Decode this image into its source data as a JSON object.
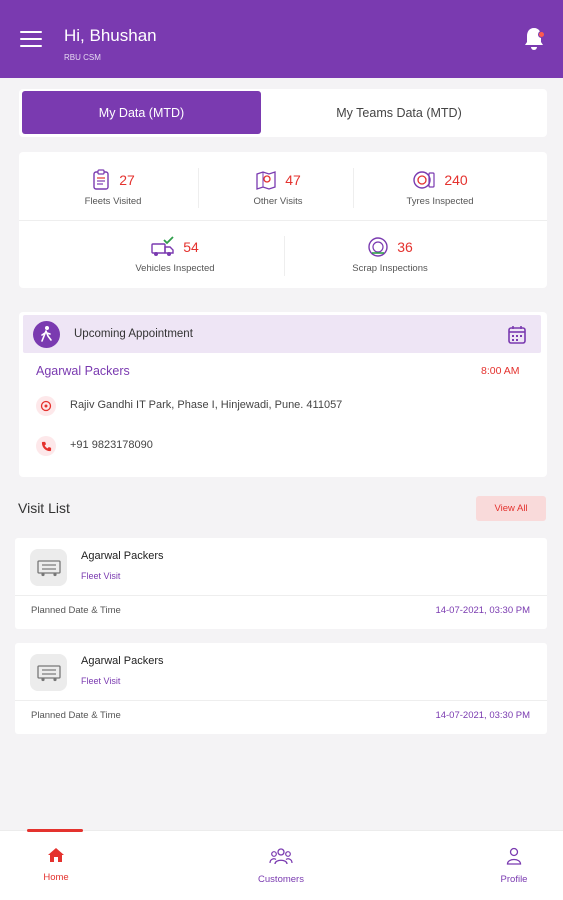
{
  "header": {
    "greeting": "Hi, Bhushan",
    "role": "RBU CSM",
    "bg_color": "#7a3ab0"
  },
  "tabs": [
    {
      "label": "My Data (MTD)",
      "active": true
    },
    {
      "label": "My Teams Data (MTD)",
      "active": false
    }
  ],
  "stats": [
    {
      "value": "27",
      "label": "Fleets Visited",
      "icon": "clipboard-icon"
    },
    {
      "value": "47",
      "label": "Other Visits",
      "icon": "map-visits-icon"
    },
    {
      "value": "240",
      "label": "Tyres Inspected",
      "icon": "tyre-icon"
    },
    {
      "value": "54",
      "label": "Vehicles Inspected",
      "icon": "truck-check-icon"
    },
    {
      "value": "36",
      "label": "Scrap Inspections",
      "icon": "scrap-tyre-icon"
    }
  ],
  "appointment": {
    "title": "Upcoming Appointment",
    "name": "Agarwal Packers",
    "time": "8:00 AM",
    "address": "Rajiv Gandhi IT Park, Phase I, Hinjewadi, Pune. 411057",
    "phone": "+91 9823178090"
  },
  "visit_list": {
    "title": "Visit List",
    "view_all_label": "View All",
    "items": [
      {
        "name": "Agarwal Packers",
        "type": "Fleet Visit",
        "planned_label": "Planned Date & Time",
        "datetime": "14-07-2021, 03:30 PM"
      },
      {
        "name": "Agarwal Packers",
        "type": "Fleet Visit",
        "planned_label": "Planned Date & Time",
        "datetime": "14-07-2021, 03:30 PM"
      }
    ]
  },
  "bottom_nav": [
    {
      "label": "Home",
      "icon": "home-icon",
      "active": true
    },
    {
      "label": "Customers",
      "icon": "customers-icon",
      "active": false
    },
    {
      "label": "Profile",
      "icon": "profile-icon",
      "active": false
    }
  ],
  "colors": {
    "accent": "#7a3ab0",
    "highlight": "#e4322e"
  }
}
